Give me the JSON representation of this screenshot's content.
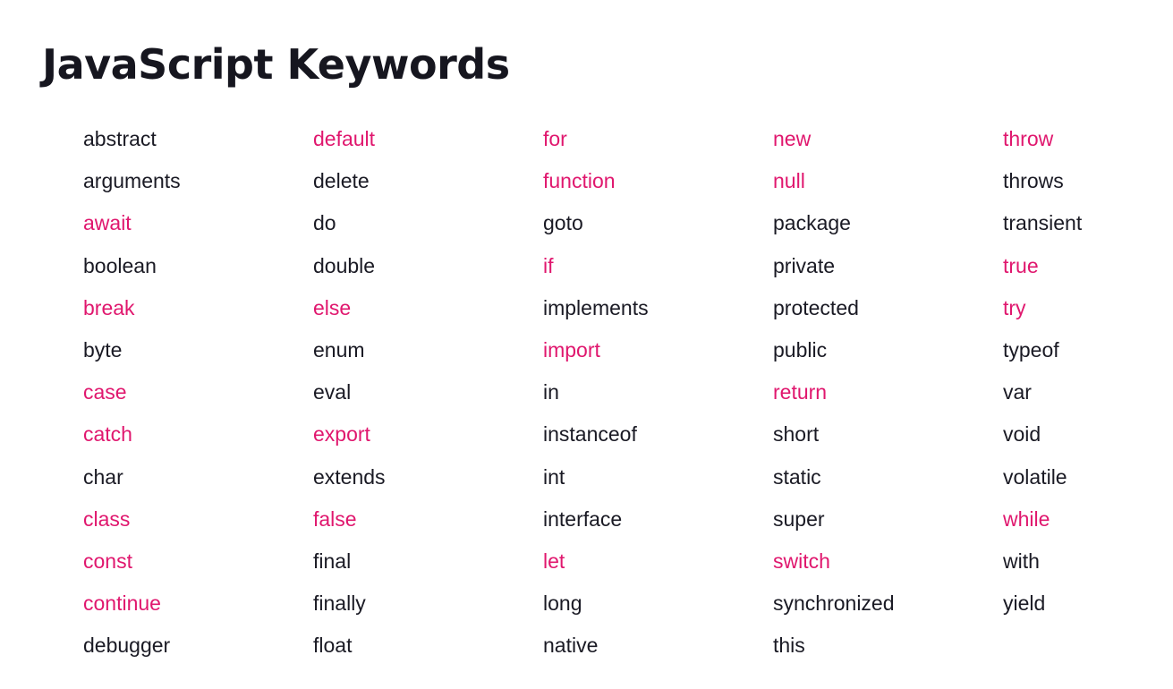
{
  "title": "JavaScript Keywords",
  "colors": {
    "plain": "#1a1a24",
    "highlight": "#e0176e"
  },
  "columns": [
    [
      {
        "text": "abstract",
        "highlighted": false
      },
      {
        "text": "arguments",
        "highlighted": false
      },
      {
        "text": "await",
        "highlighted": true
      },
      {
        "text": "boolean",
        "highlighted": false
      },
      {
        "text": "break",
        "highlighted": true
      },
      {
        "text": "byte",
        "highlighted": false
      },
      {
        "text": "case",
        "highlighted": true
      },
      {
        "text": "catch",
        "highlighted": true
      },
      {
        "text": "char",
        "highlighted": false
      },
      {
        "text": "class",
        "highlighted": true
      },
      {
        "text": "const",
        "highlighted": true
      },
      {
        "text": "continue",
        "highlighted": true
      },
      {
        "text": "debugger",
        "highlighted": false
      }
    ],
    [
      {
        "text": "default",
        "highlighted": true
      },
      {
        "text": "delete",
        "highlighted": false
      },
      {
        "text": "do",
        "highlighted": false
      },
      {
        "text": "double",
        "highlighted": false
      },
      {
        "text": "else",
        "highlighted": true
      },
      {
        "text": "enum",
        "highlighted": false
      },
      {
        "text": "eval",
        "highlighted": false
      },
      {
        "text": "export",
        "highlighted": true
      },
      {
        "text": "extends",
        "highlighted": false
      },
      {
        "text": "false",
        "highlighted": true
      },
      {
        "text": "final",
        "highlighted": false
      },
      {
        "text": "finally",
        "highlighted": false
      },
      {
        "text": "float",
        "highlighted": false
      }
    ],
    [
      {
        "text": "for",
        "highlighted": true
      },
      {
        "text": "function",
        "highlighted": true
      },
      {
        "text": "goto",
        "highlighted": false
      },
      {
        "text": "if",
        "highlighted": true
      },
      {
        "text": "implements",
        "highlighted": false
      },
      {
        "text": "import",
        "highlighted": true
      },
      {
        "text": "in",
        "highlighted": false
      },
      {
        "text": "instanceof",
        "highlighted": false
      },
      {
        "text": "int",
        "highlighted": false
      },
      {
        "text": "interface",
        "highlighted": false
      },
      {
        "text": "let",
        "highlighted": true
      },
      {
        "text": "long",
        "highlighted": false
      },
      {
        "text": "native",
        "highlighted": false
      }
    ],
    [
      {
        "text": "new",
        "highlighted": true
      },
      {
        "text": "null",
        "highlighted": true
      },
      {
        "text": "package",
        "highlighted": false
      },
      {
        "text": "private",
        "highlighted": false
      },
      {
        "text": "protected",
        "highlighted": false
      },
      {
        "text": "public",
        "highlighted": false
      },
      {
        "text": "return",
        "highlighted": true
      },
      {
        "text": "short",
        "highlighted": false
      },
      {
        "text": "static",
        "highlighted": false
      },
      {
        "text": "super",
        "highlighted": false
      },
      {
        "text": "switch",
        "highlighted": true
      },
      {
        "text": "synchronized",
        "highlighted": false
      },
      {
        "text": "this",
        "highlighted": false
      }
    ],
    [
      {
        "text": "throw",
        "highlighted": true
      },
      {
        "text": "throws",
        "highlighted": false
      },
      {
        "text": "transient",
        "highlighted": false
      },
      {
        "text": "true",
        "highlighted": true
      },
      {
        "text": "try",
        "highlighted": true
      },
      {
        "text": "typeof",
        "highlighted": false
      },
      {
        "text": "var",
        "highlighted": false
      },
      {
        "text": "void",
        "highlighted": false
      },
      {
        "text": "volatile",
        "highlighted": false
      },
      {
        "text": "while",
        "highlighted": true
      },
      {
        "text": "with",
        "highlighted": false
      },
      {
        "text": "yield",
        "highlighted": false
      }
    ]
  ]
}
